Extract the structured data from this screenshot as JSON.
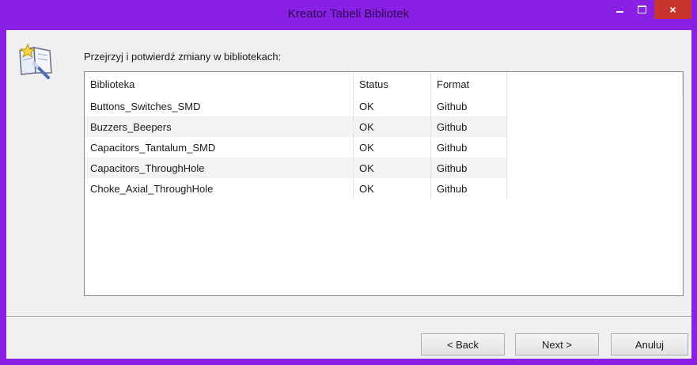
{
  "window": {
    "title": "Kreator Tabeli Bibliotek",
    "controls": {
      "minimize": "minimize-icon",
      "maximize": "maximize-icon",
      "close": "×"
    }
  },
  "colors": {
    "titlebar": "#8a1fe6",
    "close": "#c7352e",
    "client": "#f0f0f0"
  },
  "instruction": "Przejrzyj i potwierdź zmiany w bibliotekach:",
  "table": {
    "headers": [
      "Biblioteka",
      "Status",
      "Format"
    ],
    "rows": [
      [
        "Buttons_Switches_SMD",
        "OK",
        "Github"
      ],
      [
        "Buzzers_Beepers",
        "OK",
        "Github"
      ],
      [
        "Capacitors_Tantalum_SMD",
        "OK",
        "Github"
      ],
      [
        "Capacitors_ThroughHole",
        "OK",
        "Github"
      ],
      [
        "Choke_Axial_ThroughHole",
        "OK",
        "Github"
      ]
    ]
  },
  "buttons": {
    "back": "< Back",
    "next": "Next >",
    "cancel": "Anuluj"
  },
  "icons": {
    "wizard": "wizard-book-icon"
  }
}
